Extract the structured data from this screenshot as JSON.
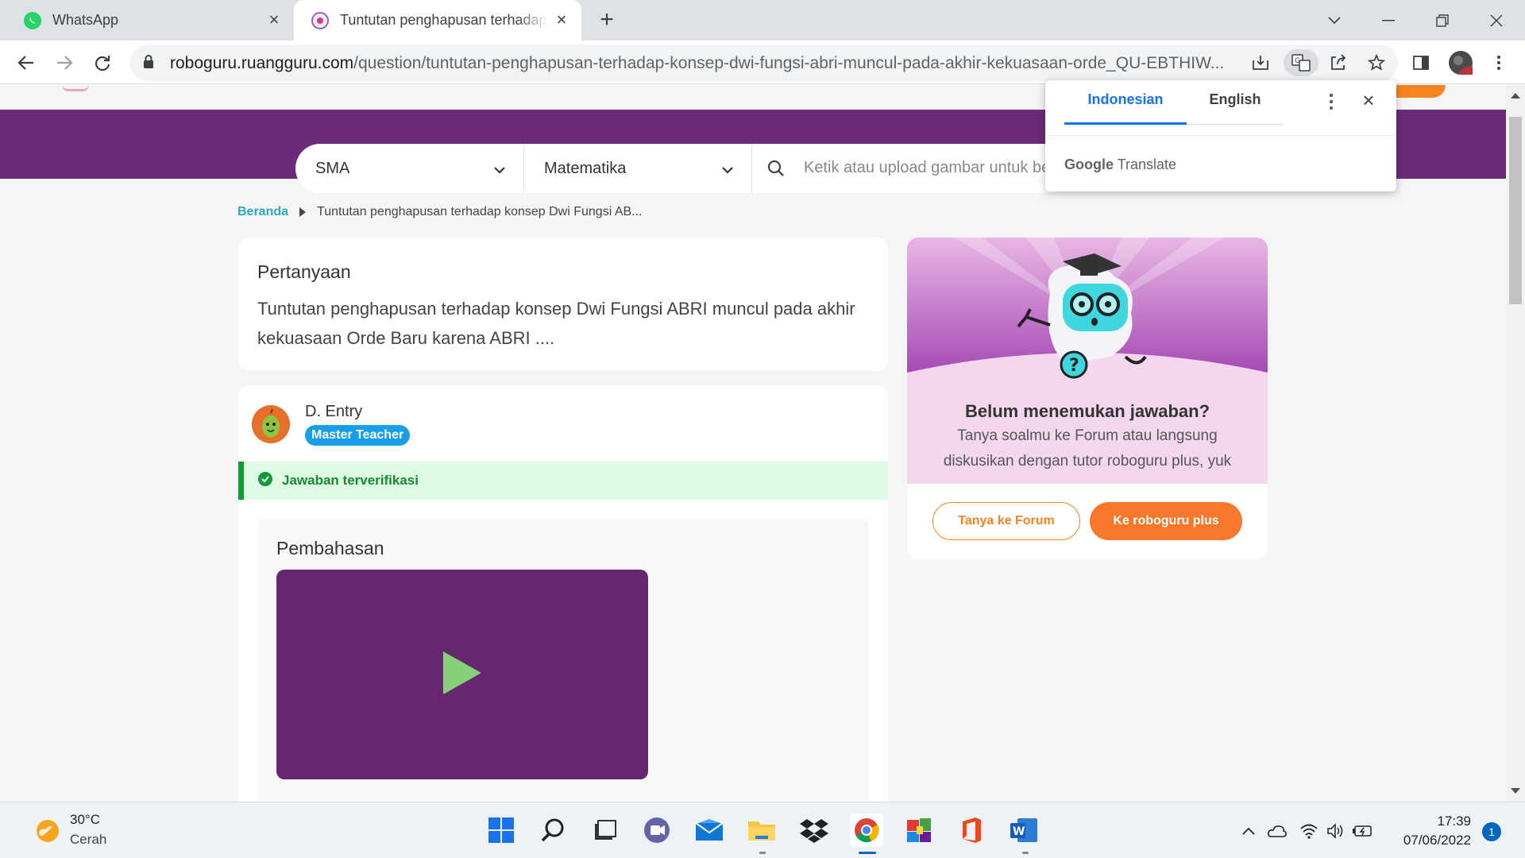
{
  "tabs": [
    {
      "title": "WhatsApp",
      "icon": "whatsapp-icon"
    },
    {
      "title": "Tuntutan penghapusan terhadap konsep Dwi Fungsi",
      "icon": "roboguru-icon"
    }
  ],
  "address_bar": {
    "domain": "roboguru.ruangguru.com",
    "path": "/question/tuntutan-penghapusan-terhadap-konsep-dwi-fungsi-abri-muncul-pada-akhir-kekuasaan-orde_QU-EBTHIW..."
  },
  "search": {
    "level": "SMA",
    "subject": "Matematika",
    "placeholder": "Ketik atau upload gambar untuk be"
  },
  "breadcrumb": {
    "home": "Beranda",
    "current": "Tuntutan penghapusan terhadap konsep Dwi Fungsi AB..."
  },
  "question": {
    "heading": "Pertanyaan",
    "text": "Tuntutan penghapusan terhadap konsep Dwi Fungsi ABRI muncul pada akhir kekuasaan Orde Baru karena ABRI ...."
  },
  "answer": {
    "author": "D. Entry",
    "badge": "Master Teacher",
    "verified": "Jawaban terverifikasi",
    "section": "Pembahasan"
  },
  "promo": {
    "title": "Belum menemukan jawaban?",
    "subtitle": "Tanya soalmu ke Forum atau langsung diskusikan dengan tutor roboguru plus, yuk",
    "forum_button": "Tanya ke Forum",
    "plus_button": "Ke roboguru plus"
  },
  "translate": {
    "lang1": "Indonesian",
    "lang2": "English",
    "footer_brand": "Google",
    "footer_product": "Translate"
  },
  "taskbar": {
    "temperature": "30°C",
    "condition": "Cerah",
    "time": "17:39",
    "date": "07/06/2022",
    "notifications": "1"
  },
  "colors": {
    "brand_purple": "#6a2b79",
    "accent_orange": "#f7841f",
    "verified_green": "#148a33",
    "link_teal": "#2ea9bf"
  }
}
